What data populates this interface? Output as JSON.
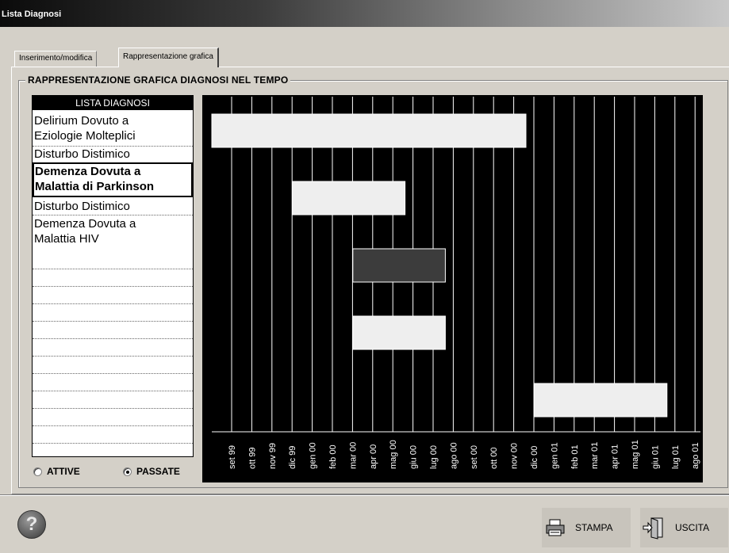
{
  "window": {
    "title": "Lista Diagnosi"
  },
  "tabs": [
    {
      "label": "Inserimento/modifica",
      "active": false
    },
    {
      "label": "Rappresentazione grafica",
      "active": true
    }
  ],
  "group": {
    "title": "RAPPRESENTAZIONE GRAFICA DIAGNOSI NEL TEMPO"
  },
  "list": {
    "header": "LISTA DIAGNOSI",
    "items": [
      {
        "line1": "Delirium Dovuto a",
        "line2": "Eziologie Molteplici",
        "selected": false
      },
      {
        "line1": "Disturbo Distimico",
        "line2": "",
        "selected": false
      },
      {
        "line1": "Demenza Dovuta a",
        "line2": "Malattia di Parkinson",
        "selected": true
      },
      {
        "line1": "Disturbo Distimico",
        "line2": "",
        "selected": false
      },
      {
        "line1": "Demenza Dovuta a",
        "line2": "Malattia HIV",
        "selected": false
      }
    ]
  },
  "filters": {
    "active_label": "ATTIVE",
    "past_label": "PASSATE",
    "selected": "PASSATE"
  },
  "timeline": {
    "months": [
      "set 99",
      "ott 99",
      "nov 99",
      "dic 99",
      "gen 00",
      "feb 00",
      "mar 00",
      "apr 00",
      "mag 00",
      "giu 00",
      "lug 00",
      "ago 00",
      "set 00",
      "ott 00",
      "nov 00",
      "dic 00",
      "gen 01",
      "feb 01",
      "mar 01",
      "apr 01",
      "mag 01",
      "giu 01",
      "lug 01",
      "ago 01"
    ],
    "bars": [
      {
        "row": 0,
        "start": "set 99",
        "end": "dic 00",
        "color": "#eeeeee"
      },
      {
        "row": 2,
        "start": "gen 00",
        "end": "giu 00",
        "color": "#eeeeee"
      },
      {
        "row": 4,
        "start": "apr 00",
        "end": "ago 00",
        "color": "#3c3c3c"
      },
      {
        "row": 6,
        "start": "apr 00",
        "end": "ago 00",
        "color": "#eeeeee"
      },
      {
        "row": 8,
        "start": "gen 01",
        "end": "lug 01",
        "color": "#eeeeee"
      }
    ]
  },
  "actions": {
    "print_label": "STAMPA",
    "exit_label": "USCITA",
    "help_icon": "help-icon",
    "print_icon": "printer-icon",
    "exit_icon": "exit-door-icon"
  }
}
